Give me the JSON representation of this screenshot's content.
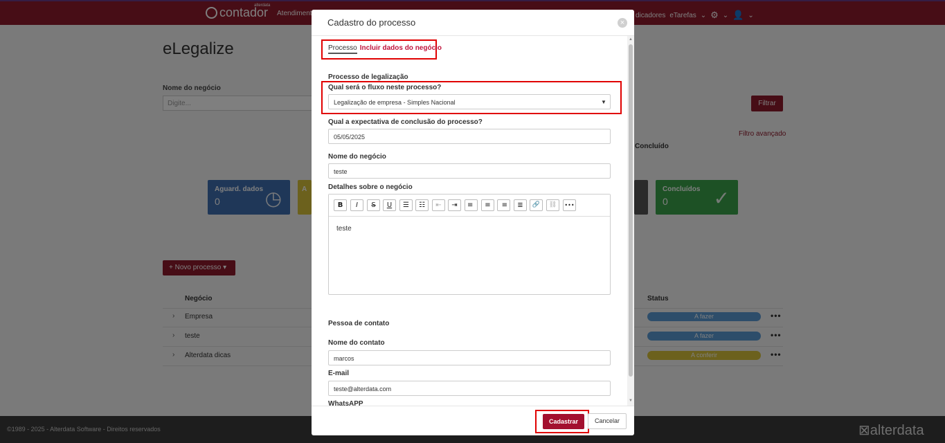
{
  "background": {
    "brand": {
      "name": "contador",
      "tag": "alterdata"
    },
    "nav_left": "Atendimento",
    "nav_right": {
      "partial": "dicadores",
      "etarefas": "eTarefas",
      "gear": "⚙",
      "user": "👤",
      "caret": "⌄"
    },
    "page_title": "eLegalize",
    "filter": {
      "label": "Nome do negócio",
      "placeholder": "Digite...",
      "button": "Filtrar",
      "advanced": "Filtro avançado"
    },
    "concluido_label": "Concluído",
    "cards": [
      {
        "label": "Aguard. dados",
        "count": "0",
        "icon": "◷"
      },
      {
        "label": "A",
        "count": "",
        "icon": ""
      },
      {
        "label": "",
        "count": "",
        "icon": ""
      },
      {
        "label": "Concluídos",
        "count": "0",
        "icon": "✓"
      }
    ],
    "new_process": "+ Novo processo ▾",
    "table": {
      "headers": {
        "negocio": "Negócio",
        "status": "Status"
      },
      "rows": [
        {
          "chevron": "›",
          "name": "Empresa",
          "status": "A fazer",
          "more": "•••"
        },
        {
          "chevron": "›",
          "name": "teste",
          "status": "A fazer",
          "more": "•••"
        },
        {
          "chevron": "›",
          "name": "Alterdata dicas",
          "status": "A conferir",
          "more": "•••"
        }
      ]
    },
    "footer": {
      "copyright": "©1989 - 2025 - Alterdata Software - Direitos reservados",
      "logo": "⊠alterdata"
    }
  },
  "modal": {
    "title": "Cadastro do processo",
    "close": "×",
    "tabs": {
      "active": "Processo",
      "inactive": "Incluir dados do negócio"
    },
    "section_process": "Processo de legalização",
    "flow": {
      "label": "Qual será o fluxo neste processo?",
      "value": "Legalização de empresa - Simples Nacional",
      "caret": "▼"
    },
    "expected": {
      "label": "Qual a expectativa de conclusão do processo?",
      "value": "05/05/2025"
    },
    "business_name": {
      "label": "Nome do negócio",
      "value": "teste"
    },
    "details": {
      "label": "Detalhes sobre o negócio",
      "content": "teste",
      "toolbar": {
        "bold": "B",
        "italic": "I",
        "strike": "S",
        "underline": "U",
        "bullets": "☰",
        "numbers": "☷",
        "outdent": "⇤",
        "indent": "⇥",
        "align_left": "≡",
        "align_center": "≡",
        "align_right": "≡",
        "justify": "≣",
        "link": "🔗",
        "unlink": "⛓",
        "more": "•••"
      }
    },
    "section_contact": "Pessoa de contato",
    "contact_name": {
      "label": "Nome do contato",
      "value": "marcos"
    },
    "email": {
      "label": "E-mail",
      "value": "teste@alterdata.com"
    },
    "whatsapp": {
      "label": "WhatsAPP"
    },
    "scroll": {
      "up": "▲",
      "down": "▼"
    },
    "submit": "Cadastrar",
    "cancel": "Cancelar"
  },
  "colors": {
    "brand": "#8e1a2c",
    "highlight": "#e00000",
    "submit": "#a3102f",
    "tab_link": "#c0143c"
  }
}
